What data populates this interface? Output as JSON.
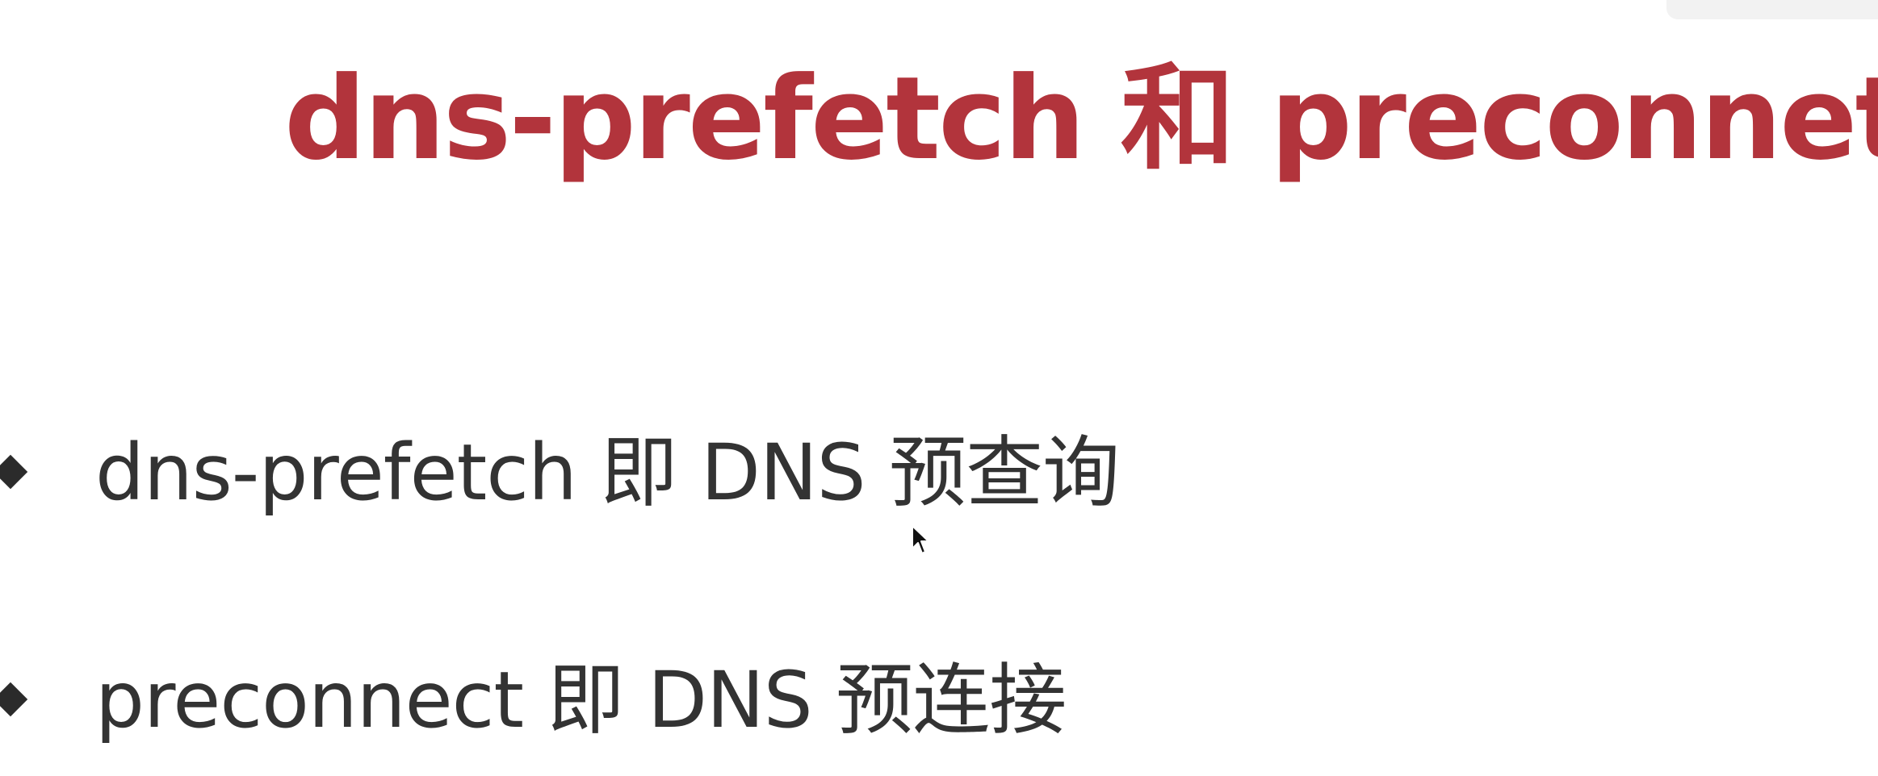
{
  "slide": {
    "title": "dns-prefetch 和 preconnet",
    "bullets": [
      {
        "text": "dns-prefetch 即 DNS 预查询"
      },
      {
        "text": "preconnect 即 DNS 预连接"
      }
    ]
  },
  "colors": {
    "title": "#b2343c",
    "body_text": "#333333",
    "bullet_marker": "#2b2b2b",
    "background": "#ffffff"
  },
  "icons": {
    "bullet": "diamond-bullet-icon",
    "pointer": "mouse-cursor-icon"
  }
}
